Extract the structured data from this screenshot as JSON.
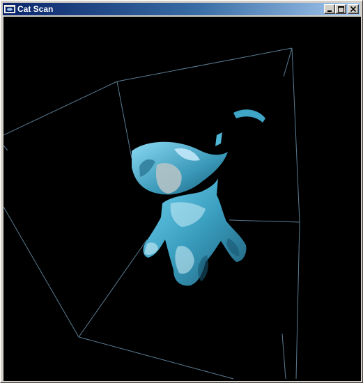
{
  "window": {
    "title": "Cat Scan",
    "icon": "app-window-icon",
    "controls": [
      "minimize-icon",
      "maximize-icon",
      "close-icon"
    ]
  },
  "viewport": {
    "background_color": "#000000",
    "wireframe_color": "#5a7d93",
    "model_color": "#4fb6d6"
  }
}
